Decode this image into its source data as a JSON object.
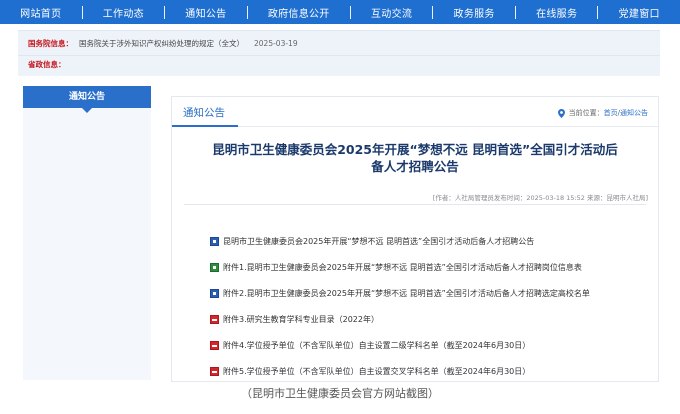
{
  "nav": {
    "items": [
      "网站首页",
      "工作动态",
      "通知公告",
      "政府信息公开",
      "互动交流",
      "政务服务",
      "在线服务",
      "党建窗口"
    ]
  },
  "notice": {
    "row1_label": "国务院信息：",
    "row1_text": "国务院关于涉外知识产权纠纷处理的规定（全文）",
    "row1_date": "2025-03-19",
    "row2_label": "省政信息："
  },
  "sidebar": {
    "tab_label": "通知公告"
  },
  "main": {
    "section_title": "通知公告",
    "crumb_prefix": "当前位置：",
    "crumb_home": "首页",
    "crumb_sep": "/",
    "crumb_section": "通知公告",
    "article_title_line1": "昆明市卫生健康委员会2025年开展“梦想不远 昆明首选”全国引才活动后",
    "article_title_line2": "备人才招聘公告",
    "meta": "[作者：人社局管理员发布时间：2025-03-18 15:52 来源：昆明市人社局]"
  },
  "files": [
    {
      "icon": "doc-icon",
      "text": "昆明市卫生健康委员会2025年开展“梦想不远 昆明首选”全国引才活动后备人才招聘公告"
    },
    {
      "icon": "xls-icon",
      "text": "附件1.昆明市卫生健康委员会2025年开展“梦想不远 昆明首选”全国引才活动后备人才招聘岗位信息表"
    },
    {
      "icon": "doc-icon",
      "text": "附件2.昆明市卫生健康委员会2025年开展“梦想不远 昆明首选”全国引才活动后备人才招聘选定高校名单"
    },
    {
      "icon": "pdf-icon",
      "text": "附件3.研究生教育学科专业目录（2022年）"
    },
    {
      "icon": "pdf-icon",
      "text": "附件4.学位授予单位（不含军队单位）自主设置二级学科名单（截至2024年6月30日）"
    },
    {
      "icon": "pdf-icon",
      "text": "附件5.学位授予单位（不含军队单位）自主设置交叉学科名单（截至2024年6月30日）"
    }
  ],
  "caption": "（昆明市卫生健康委员会官方网站截图）",
  "colors": {
    "nav_bg": "#1f6fd0",
    "accent": "#2a6fc9",
    "title": "#1b3a6b",
    "label_red": "#c4161c"
  }
}
